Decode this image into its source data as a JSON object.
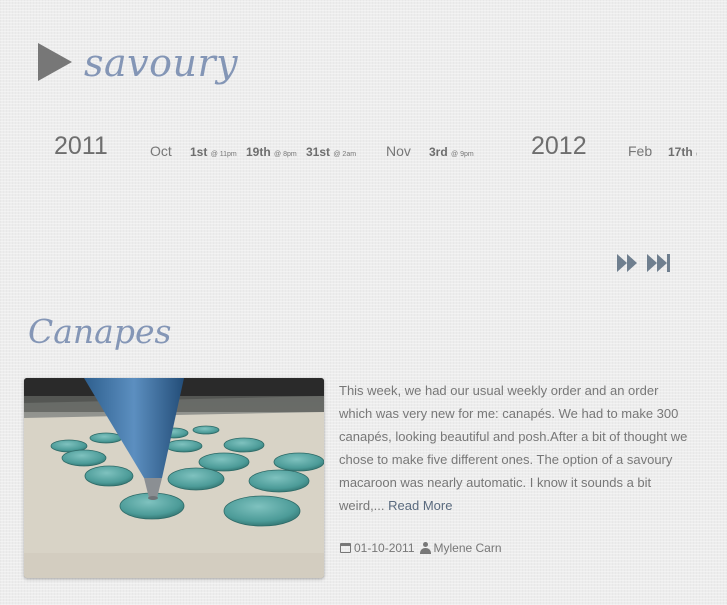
{
  "header": {
    "site_title": "savoury"
  },
  "timeline": {
    "entries": [
      {
        "kind": "year",
        "label": "2011"
      },
      {
        "kind": "month",
        "label": "Oct"
      },
      {
        "kind": "day",
        "label": "1st",
        "time": "@ 11pm"
      },
      {
        "kind": "day",
        "label": "19th",
        "time": "@ 8pm"
      },
      {
        "kind": "day",
        "label": "31st",
        "time": "@ 2am"
      },
      {
        "kind": "month",
        "label": "Nov"
      },
      {
        "kind": "day",
        "label": "3rd",
        "time": "@ 9pm"
      },
      {
        "kind": "year",
        "label": "2012"
      },
      {
        "kind": "month",
        "label": "Feb"
      },
      {
        "kind": "day",
        "label": "17th",
        "time": "@"
      }
    ]
  },
  "navigation": {
    "forward_icon": "fast-forward-icon",
    "last_icon": "skip-to-end-icon"
  },
  "post": {
    "title": "Canapes",
    "excerpt": "This week, we had our usual weekly order and an order which was very new for me: canapés. We had to make 300 canapés, looking beautiful and posh.After a bit of thought we chose to make five different ones. The option of a savoury macaroon was nearly automatic. I know it sounds a bit weird,...",
    "read_more": "Read More",
    "date": "01-10-2011",
    "author": "Mylene Carn"
  },
  "colors": {
    "title_blue": "#8496b6",
    "text_gray": "#777777",
    "link_blue": "#5a6a7e",
    "background": "#ededed"
  }
}
